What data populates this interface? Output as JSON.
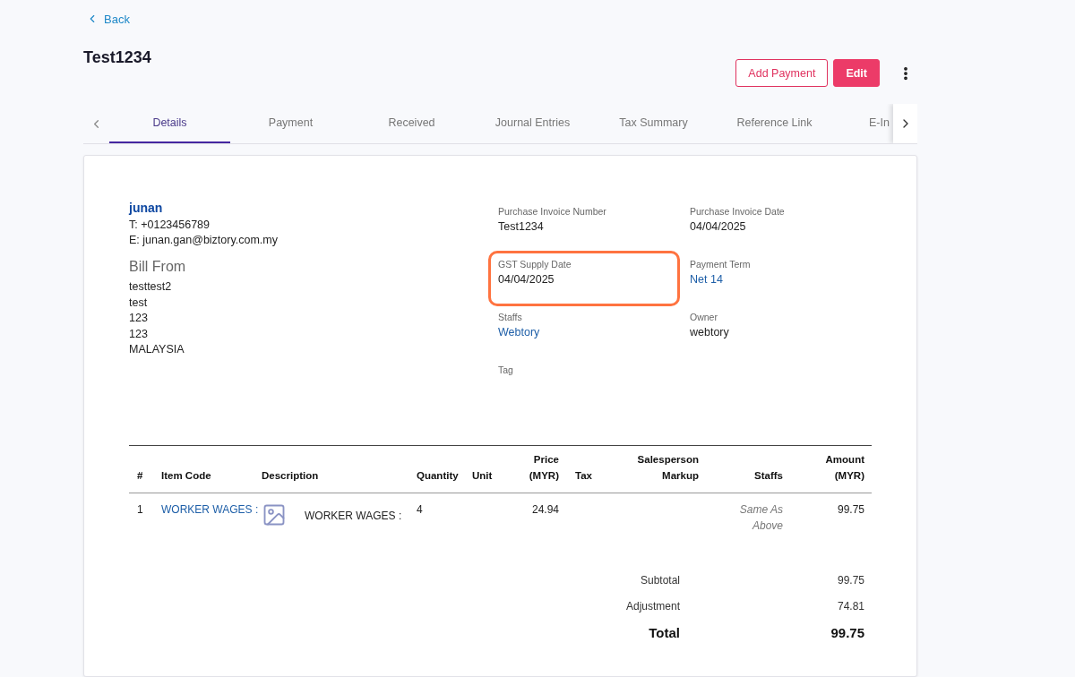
{
  "back": "Back",
  "title": "Test1234",
  "actions": [
    {
      "label": "Add Payment",
      "kind": "outline"
    },
    {
      "label": "Edit",
      "kind": "primary"
    }
  ],
  "tabs": [
    {
      "label": "Details",
      "selected": true
    },
    {
      "label": "Payment",
      "selected": false
    },
    {
      "label": "Received",
      "selected": false
    },
    {
      "label": "Journal Entries",
      "selected": false
    },
    {
      "label": "Tax Summary",
      "selected": false
    },
    {
      "label": "Reference Link",
      "selected": false
    },
    {
      "label": "E-In",
      "selected": false
    }
  ],
  "contact": {
    "name": "junan",
    "phone": "T: +0123456789",
    "email": "E: junan.gan@biztory.com.my"
  },
  "bill_from": {
    "heading": "Bill From",
    "lines": [
      "testtest2",
      "test",
      "123",
      "123",
      "MALAYSIA"
    ]
  },
  "fields": [
    {
      "label": "Purchase Invoice Number",
      "value": "Test1234",
      "kind": "text",
      "highlighted": false
    },
    {
      "label": "Purchase Invoice Date",
      "value": "04/04/2025",
      "kind": "text",
      "highlighted": false
    },
    {
      "label": "GST Supply Date",
      "value": "04/04/2025",
      "kind": "text",
      "highlighted": true
    },
    {
      "label": "Payment Term",
      "value": "Net 14",
      "kind": "link",
      "highlighted": false
    },
    {
      "label": "Staffs",
      "value": "Webtory",
      "kind": "link",
      "highlighted": false
    },
    {
      "label": "Owner",
      "value": "webtory",
      "kind": "text",
      "highlighted": false
    },
    {
      "label": "Tag",
      "highlighted": false
    }
  ],
  "table": {
    "columns": [
      "#",
      "Item Code",
      "Description",
      "Quantity",
      "Unit",
      "Price (MYR)",
      "Tax",
      "Salesperson Markup",
      "Staffs",
      "Amount (MYR)"
    ],
    "rows": [
      {
        "number": "1",
        "item_code": "WORKER WAGES :",
        "description": "WORKER WAGES :",
        "quantity": "4",
        "price": "24.94",
        "staffs": "Same As Above",
        "amount": "99.75"
      }
    ]
  },
  "totals": [
    {
      "label": "Subtotal",
      "value": "99.75",
      "kind": "normal"
    },
    {
      "label": "Adjustment",
      "value": "74.81",
      "kind": "normal"
    },
    {
      "label": "Total",
      "value": "99.75",
      "kind": "grand"
    }
  ]
}
